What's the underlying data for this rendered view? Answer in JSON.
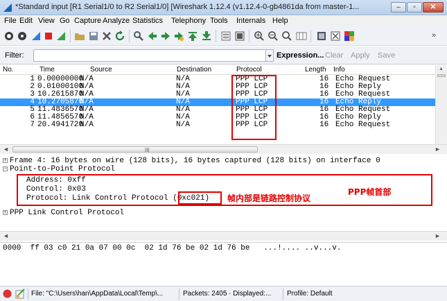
{
  "window": {
    "title": "*Standard input  [R1 Serial1/0 to R2 Serial1/0]  [Wireshark 1.12.4  (v1.12.4-0-gb4861da from master-1...",
    "min_glyph": "–",
    "max_glyph": "▫",
    "close_glyph": "✕"
  },
  "menu": [
    "File",
    "Edit",
    "View",
    "Go",
    "Capture",
    "Analyze",
    "Statistics",
    "Telephony",
    "Tools",
    "Internals",
    "Help"
  ],
  "toolbar": {
    "icons": [
      "interface-list-icon",
      "capture-options-icon",
      "start-capture-icon",
      "stop-capture-icon",
      "restart-capture-icon",
      "open-file-icon",
      "save-file-icon",
      "close-file-icon",
      "reload-icon",
      "find-packet-icon",
      "go-back-icon",
      "go-forward-icon",
      "go-to-packet-icon",
      "go-first-icon",
      "go-last-icon",
      "colorize-icon",
      "autoscroll-icon",
      "zoom-in-icon",
      "zoom-out-icon",
      "zoom-normal-icon",
      "resize-columns-icon",
      "capture-filters-icon",
      "display-filters-icon",
      "coloring-rules-icon"
    ],
    "overflow": "»"
  },
  "filter": {
    "label": "Filter:",
    "value": "",
    "expression": "Expression...",
    "clear": "Clear",
    "apply": "Apply",
    "save": "Save"
  },
  "packet_list": {
    "columns": [
      "No.",
      "Time",
      "Source",
      "Destination",
      "Protocol",
      "Length",
      "Info"
    ],
    "rows": [
      {
        "no": "1",
        "time": "0.00000000",
        "src": "N/A",
        "dst": "N/A",
        "proto": "PPP LCP",
        "len": "16",
        "info": "Echo Request"
      },
      {
        "no": "2",
        "time": "0.01000100",
        "src": "N/A",
        "dst": "N/A",
        "proto": "PPP LCP",
        "len": "16",
        "info": "Echo Reply"
      },
      {
        "no": "3",
        "time": "10.2615870",
        "src": "N/A",
        "dst": "N/A",
        "proto": "PPP LCP",
        "len": "16",
        "info": "Echo Request"
      },
      {
        "no": "4",
        "time": "10.2705870",
        "src": "N/A",
        "dst": "N/A",
        "proto": "PPP LCP",
        "len": "16",
        "info": "Echo Reply"
      },
      {
        "no": "5",
        "time": "11.4836570",
        "src": "N/A",
        "dst": "N/A",
        "proto": "PPP LCP",
        "len": "16",
        "info": "Echo Request"
      },
      {
        "no": "6",
        "time": "11.4856570",
        "src": "N/A",
        "dst": "N/A",
        "proto": "PPP LCP",
        "len": "16",
        "info": "Echo Reply"
      },
      {
        "no": "7",
        "time": "20.4941720",
        "src": "N/A",
        "dst": "N/A",
        "proto": "PPP LCP",
        "len": "16",
        "info": "Echo Request"
      }
    ],
    "selected_index": 3,
    "scroll_grip": "III"
  },
  "details": {
    "frame": "Frame 4: 16 bytes on wire (128 bits), 16 bytes captured (128 bits) on interface 0",
    "ppp": "Point-to-Point Protocol",
    "address": "Address: 0xff",
    "control": "Control: 0x03",
    "protocol_prefix": "Protocol: Link Control Protocol ",
    "protocol_code": "(0xc021)",
    "lcp": "PPP Link Control Protocol",
    "annotation_inner": "帧内部是链路控制协议",
    "annotation_header": "PPP帧首部",
    "toggle_collapsed": "+",
    "toggle_expanded": "−"
  },
  "bytes": {
    "line": "0000  ff 03 c0 21 0a 07 00 0c  02 1d 76 be 02 1d 76 be   ...!.... ..v...v."
  },
  "status": {
    "file": "File: \"C:\\Users\\han\\AppData\\Local\\Temp\\...",
    "packets": "Packets: 2405 · Displayed:...",
    "profile": "Profile: Default"
  },
  "colors": {
    "selection": "#3399ff",
    "annotation": "#e20000",
    "link_enabled": "#000000",
    "link_disabled": "#9a9a9a"
  }
}
